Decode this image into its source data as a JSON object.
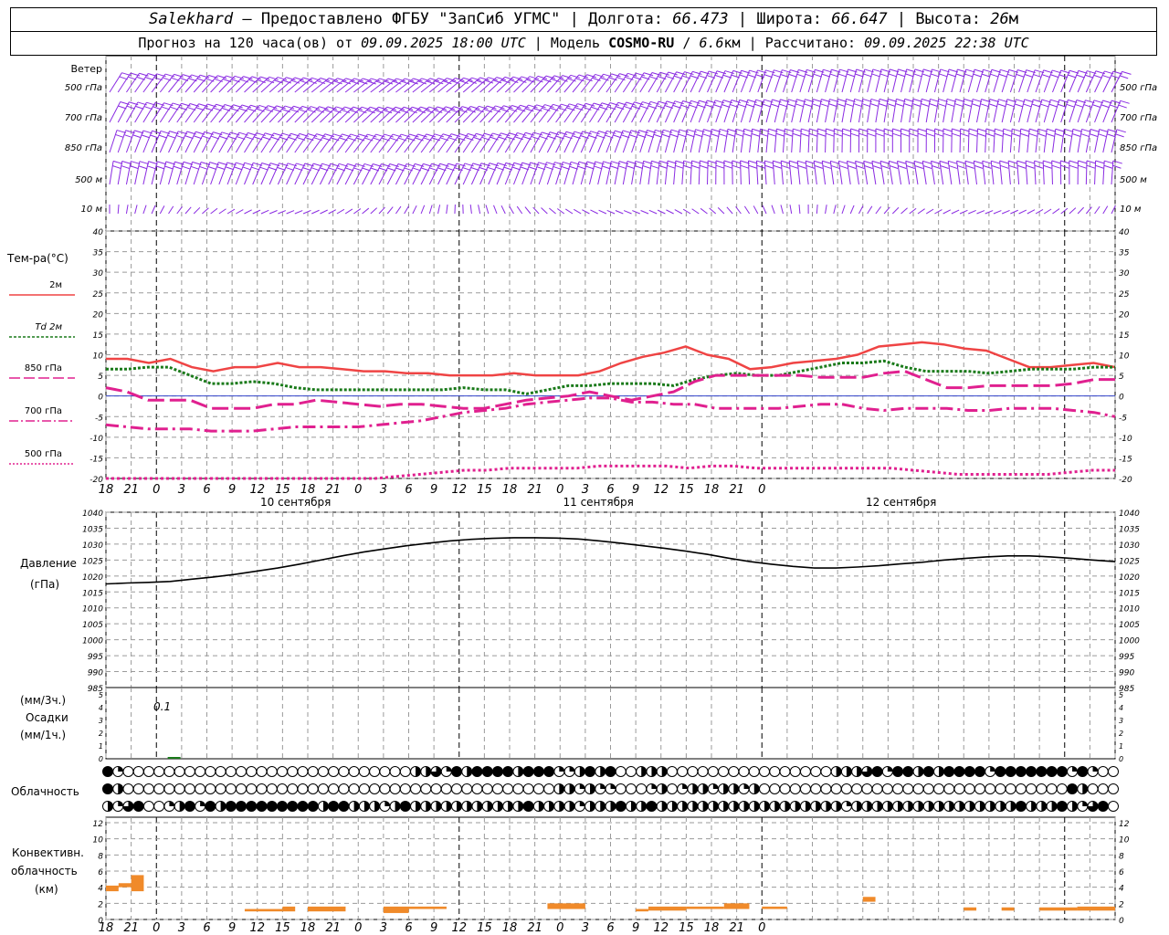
{
  "header": {
    "station": "Salekhard",
    "provider": "– Предоставлено ФГБУ \"ЗапСиб УГМС\"",
    "lon_label": "Долгота:",
    "lon_value": "66.473",
    "lat_label": "Широта:",
    "lat_value": "66.647",
    "alt_label": "Высота:",
    "alt_value": "26",
    "alt_unit": "м",
    "forecast_label": "Прогноз на 120 часа(ов) от",
    "forecast_from": "09.09.2025 18:00 UTC",
    "model_label": "Модель",
    "model_name": "COSMO-RU",
    "model_res": "6.6",
    "model_res_unit": "км",
    "calc_label": "Рассчитано:",
    "calc_time": "09.09.2025 22:38 UTC"
  },
  "colors": {
    "t2m": "#ef4444",
    "td2m": "#1a7a1a",
    "t850": "#e0208f",
    "t700": "#e0208f",
    "t500": "#e0208f",
    "pressure": "#000000",
    "wind": "#8a2be2",
    "conv": "#f08a2a",
    "precip": "#1a7a1a",
    "zero_line": "#3344cc"
  },
  "time_axis": {
    "hour_labels": [
      "18",
      "21",
      "0",
      "3",
      "6",
      "9",
      "12",
      "15",
      "18",
      "21",
      "0",
      "3",
      "6",
      "9",
      "12",
      "15",
      "18",
      "21",
      "0",
      "3",
      "6",
      "9",
      "12",
      "15",
      "18",
      "21",
      "0"
    ],
    "date_labels": [
      "10 сентября",
      "11 сентября",
      "12 сентября"
    ]
  },
  "wind_panel": {
    "title": "Ветер",
    "levels": [
      "500 гПа",
      "700 гПа",
      "850 гПа",
      "500 м",
      "10 м"
    ],
    "levels_right": [
      "500 гПа",
      "700 гПа",
      "850 гПа",
      "500 м",
      "10 м"
    ]
  },
  "temp_panel": {
    "title": "Тем-ра(°С)",
    "legend": [
      {
        "label": "2м"
      },
      {
        "label": "Td 2м"
      },
      {
        "label": "850 гПа"
      },
      {
        "label": "700 гПа"
      },
      {
        "label": "500 гПа"
      }
    ],
    "yticks": [
      "40",
      "35",
      "30",
      "25",
      "20",
      "15",
      "10",
      "5",
      "0",
      "-5",
      "-10",
      "-15",
      "-20"
    ]
  },
  "pressure_panel": {
    "title": "Давление",
    "unit": "(гПа)",
    "yticks": [
      "1040",
      "1035",
      "1030",
      "1025",
      "1020",
      "1015",
      "1010",
      "1005",
      "1000",
      "995",
      "990",
      "985"
    ]
  },
  "precip_panel": {
    "unit_top": "(мм/3ч.)",
    "title": "Осадки",
    "unit_bottom": "(мм/1ч.)",
    "yticks": [
      "5",
      "4",
      "3",
      "2",
      "1",
      "0"
    ],
    "annotation": "0.1"
  },
  "cloud_panel": {
    "title": "Облачность"
  },
  "conv_panel": {
    "title_lines": [
      "Конвективн.",
      "облачность",
      "(км)"
    ],
    "yticks": [
      "12",
      "10",
      "8",
      "6",
      "4",
      "2",
      "0"
    ]
  },
  "chart_data": [
    {
      "type": "line",
      "title": "Тем-ра(°С)",
      "x_hours_from_start": [
        0,
        3,
        6,
        9,
        12,
        15,
        18,
        21,
        24,
        27,
        30,
        33,
        36,
        39,
        42,
        45,
        48,
        51,
        54,
        57,
        60,
        63,
        66,
        69,
        72,
        75,
        78,
        81,
        84,
        87,
        90,
        93,
        96,
        99,
        102,
        105,
        108,
        111,
        114,
        117,
        120
      ],
      "ylim": [
        -20,
        40
      ],
      "series": [
        {
          "name": "2м",
          "values": [
            9,
            9,
            8,
            9,
            7,
            6,
            7,
            7,
            8,
            7,
            7,
            6.5,
            6,
            6,
            5.5,
            5.5,
            5,
            5,
            5,
            5.5,
            5,
            5,
            5,
            6,
            8,
            9.5,
            10.5,
            12,
            10,
            9,
            6.5,
            7,
            8,
            8.5,
            9,
            10,
            12,
            12.5,
            13,
            12.5,
            11.5,
            11,
            9,
            7,
            7,
            7.5,
            8,
            7
          ]
        },
        {
          "name": "Td 2м",
          "values": [
            6.5,
            6.5,
            7,
            7,
            5,
            3,
            3,
            3.5,
            3,
            2,
            1.5,
            1.5,
            1.5,
            1.5,
            1.5,
            1.5,
            1.5,
            2,
            1.5,
            1.5,
            0.5,
            1.5,
            2.5,
            2.5,
            3,
            3,
            3,
            2.5,
            4,
            5,
            5.5,
            5,
            5,
            6,
            7,
            8,
            8,
            8.5,
            7,
            6,
            6,
            6,
            5.5,
            6,
            6.5,
            6.5,
            6.5,
            7,
            7
          ]
        },
        {
          "name": "850 гПа",
          "values": [
            2,
            1,
            -1,
            -1,
            -1,
            -3,
            -3,
            -3,
            -2,
            -2,
            -1,
            -1.5,
            -2,
            -2.5,
            -2,
            -2,
            -2.5,
            -3,
            -3,
            -2,
            -1,
            -0.5,
            0,
            1,
            0,
            -1,
            0,
            1,
            3.5,
            5,
            5,
            5,
            5,
            5,
            4.5,
            4.5,
            4.5,
            5.5,
            6,
            4,
            2,
            2,
            2.5,
            2.5,
            2.5,
            2.5,
            3,
            4,
            4
          ]
        },
        {
          "name": "700 гПа",
          "values": [
            -7,
            -7.5,
            -8,
            -8,
            -8,
            -8.5,
            -8.5,
            -8.5,
            -8,
            -7.5,
            -7.5,
            -7.5,
            -7.5,
            -7,
            -6.5,
            -6,
            -5,
            -4,
            -3.5,
            -3,
            -2,
            -1.5,
            -1,
            -0.5,
            -0.5,
            -1.5,
            -1.5,
            -2,
            -2,
            -3,
            -3,
            -3,
            -3,
            -2.5,
            -2,
            -2,
            -3,
            -3.5,
            -3,
            -3,
            -3,
            -3.5,
            -3.5,
            -3,
            -3,
            -3,
            -3.5,
            -4,
            -5
          ]
        },
        {
          "name": "500 гПа",
          "values": [
            -21,
            -21,
            -21,
            -21,
            -21,
            -21,
            -21,
            -21,
            -21,
            -21,
            -21,
            -20.5,
            -20,
            -19.5,
            -19,
            -18.5,
            -18,
            -18,
            -17.5,
            -17.5,
            -17.5,
            -17.5,
            -17,
            -17,
            -17,
            -17,
            -17.5,
            -17,
            -17,
            -17.5,
            -17.5,
            -17.5,
            -17.5,
            -17.5,
            -17.5,
            -17.5,
            -18,
            -18.5,
            -19,
            -19,
            -19,
            -19,
            -19,
            -18.5,
            -18,
            -18
          ]
        }
      ]
    },
    {
      "type": "line",
      "title": "Давление",
      "ylabel": "(гПа)",
      "ylim": [
        985,
        1040
      ],
      "series": [
        {
          "name": "Давление",
          "values": [
            1017.5,
            1017.8,
            1018,
            1018.3,
            1019,
            1019.7,
            1020.5,
            1021.5,
            1022.5,
            1023.7,
            1025,
            1026.3,
            1027.5,
            1028.5,
            1029.5,
            1030.3,
            1031,
            1031.5,
            1031.8,
            1032,
            1032,
            1031.9,
            1031.6,
            1031,
            1030.3,
            1029.5,
            1028.7,
            1027.8,
            1026.8,
            1025.6,
            1024.5,
            1023.7,
            1023,
            1022.5,
            1022.5,
            1022.8,
            1023.2,
            1023.8,
            1024.3,
            1025,
            1025.5,
            1026,
            1026.3,
            1026.3,
            1026,
            1025.5,
            1025,
            1024.5
          ]
        }
      ]
    },
    {
      "type": "bar",
      "title": "Осадки",
      "ylim": [
        0,
        5
      ],
      "series": [
        {
          "name": "Осадки",
          "values": [
            0,
            0.1,
            0,
            0,
            0,
            0,
            0,
            0,
            0,
            0,
            0,
            0,
            0,
            0,
            0,
            0,
            0,
            0,
            0,
            0,
            0,
            0,
            0,
            0,
            0,
            0,
            0,
            0,
            0,
            0,
            0,
            0,
            0,
            0,
            0,
            0,
            0,
            0,
            0,
            0,
            0
          ]
        }
      ]
    },
    {
      "type": "bar",
      "title": "Конвективн. облачность (км)",
      "ylim": [
        0,
        13
      ],
      "bars": [
        {
          "t0": 0,
          "t1": 1,
          "base": 3.5,
          "top": 4.2
        },
        {
          "t0": 1,
          "t1": 2,
          "base": 4.0,
          "top": 4.5
        },
        {
          "t0": 2,
          "t1": 3,
          "base": 3.5,
          "top": 5.5
        },
        {
          "t0": 11,
          "t1": 14,
          "base": 1.0,
          "top": 1.3
        },
        {
          "t0": 14,
          "t1": 15,
          "base": 1.0,
          "top": 1.6
        },
        {
          "t0": 16,
          "t1": 19,
          "base": 1.0,
          "top": 1.6
        },
        {
          "t0": 22,
          "t1": 24,
          "base": 0.8,
          "top": 1.6
        },
        {
          "t0": 24,
          "t1": 27,
          "base": 1.3,
          "top": 1.6
        },
        {
          "t0": 35,
          "t1": 38,
          "base": 1.3,
          "top": 2.0
        },
        {
          "t0": 42,
          "t1": 43,
          "base": 1.0,
          "top": 1.3
        },
        {
          "t0": 43,
          "t1": 46,
          "base": 1.1,
          "top": 1.6
        },
        {
          "t0": 46,
          "t1": 49,
          "base": 1.3,
          "top": 1.6
        },
        {
          "t0": 49,
          "t1": 51,
          "base": 1.3,
          "top": 2.0
        },
        {
          "t0": 52,
          "t1": 54,
          "base": 1.3,
          "top": 1.6
        },
        {
          "t0": 60,
          "t1": 61,
          "base": 2.2,
          "top": 2.8
        },
        {
          "t0": 68,
          "t1": 69,
          "base": 1.1,
          "top": 1.5
        },
        {
          "t0": 71,
          "t1": 72,
          "base": 1.1,
          "top": 1.5
        },
        {
          "t0": 74,
          "t1": 77,
          "base": 1.1,
          "top": 1.5
        },
        {
          "t0": 77,
          "t1": 80,
          "base": 1.1,
          "top": 1.6
        }
      ]
    }
  ]
}
